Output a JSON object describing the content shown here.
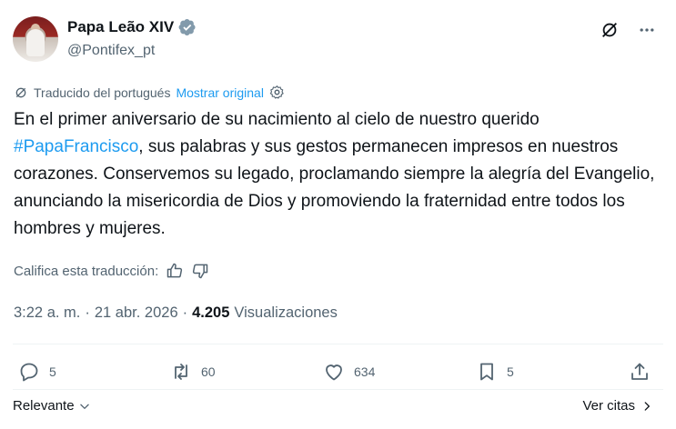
{
  "author": {
    "name": "Papa Leão XIV",
    "handle": "@Pontifex_pt",
    "avatar_icon": "avatar-pope"
  },
  "translation": {
    "label": "Traducido del portugués",
    "show_original": "Mostrar original"
  },
  "post": {
    "text_before": "En el primer aniversario de su nacimiento al cielo de nuestro querido ",
    "hashtag": "#PapaFrancisco",
    "text_after": ", sus palabras y sus gestos permanecen impresos en nuestros corazones. Conservemos su legado, proclamando siempre la alegría del Evangelio, anunciando la misericordia de Dios y promoviendo la fraternidad entre todos los hombres y mujeres."
  },
  "rate": {
    "label": "Califica esta traducción:"
  },
  "meta": {
    "time": "3:22 a. m.",
    "sep1": "·",
    "date": "21 abr. 2026",
    "sep2": "·",
    "views": "4.205",
    "views_label": "Visualizaciones"
  },
  "actions": {
    "replies": "5",
    "reposts": "60",
    "likes": "634",
    "bookmarks": "5"
  },
  "footer": {
    "sort_label": "Relevante",
    "quotes_label": "Ver citas"
  },
  "colors": {
    "accent": "#1d9bf0",
    "muted": "#536471",
    "text": "#0f1419"
  }
}
